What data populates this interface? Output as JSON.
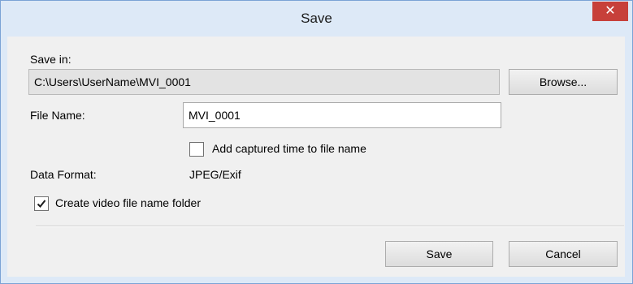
{
  "window": {
    "title": "Save",
    "close_glyph": "✕"
  },
  "save_in": {
    "label": "Save in:",
    "path": "C:\\Users\\UserName\\MVI_0001",
    "browse_label": "Browse..."
  },
  "file_name": {
    "label": "File Name:",
    "value": "MVI_0001"
  },
  "add_time": {
    "label": "Add captured time to file name",
    "checked": false
  },
  "data_format": {
    "label": "Data Format:",
    "value": "JPEG/Exif"
  },
  "create_folder": {
    "label": "Create video file name folder",
    "checked": true
  },
  "buttons": {
    "save_label": "Save",
    "cancel_label": "Cancel"
  },
  "colors": {
    "title_bar": "#dde9f7",
    "close_button": "#c7403a",
    "content_bg": "#f0f0f0"
  }
}
